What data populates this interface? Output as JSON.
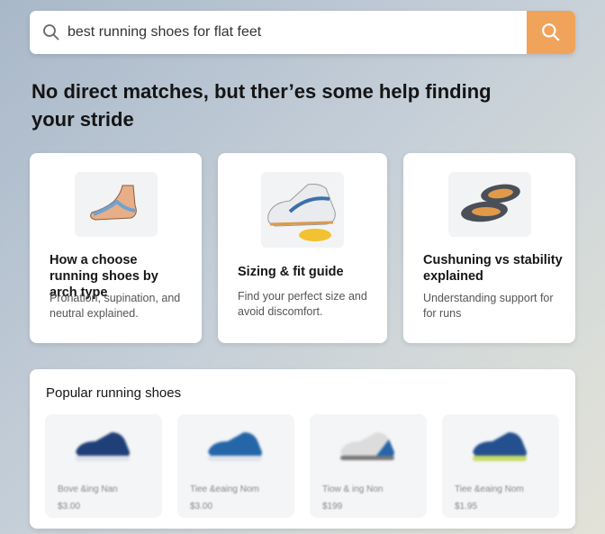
{
  "search": {
    "value": "best running shoes for flat feet",
    "button_icon": "search-icon",
    "accent": "#f0a35a"
  },
  "heading": "No direct matches, but ther’es some help finding your stride",
  "cards": [
    {
      "title": "How a choose running shoes by arch type",
      "desc": "Pronation, supination, and neutral explained.",
      "image": "foot-arch-illustration"
    },
    {
      "title": "Sizing & fit guide",
      "desc": "Find your perfect size and avoid discomfort.",
      "image": "shoe-with-measuring-tape"
    },
    {
      "title": "Cushuning vs stability explained",
      "desc": "Understanding support for for runs",
      "image": "shoe-soles"
    }
  ],
  "popular": {
    "title": "Popular running shoes",
    "items": [
      {
        "name": "Bove &ing Nan",
        "price": "$3.00",
        "color": "#1f3f78"
      },
      {
        "name": "Tiee &eaing Nom",
        "price": "$3.00",
        "color": "#2566a8"
      },
      {
        "name": "Tiow & ing Non",
        "price": "$199",
        "color": "#dcdcdc"
      },
      {
        "name": "Tiee &eaing Nom",
        "price": "$1.95",
        "color": "#24508f"
      }
    ]
  }
}
